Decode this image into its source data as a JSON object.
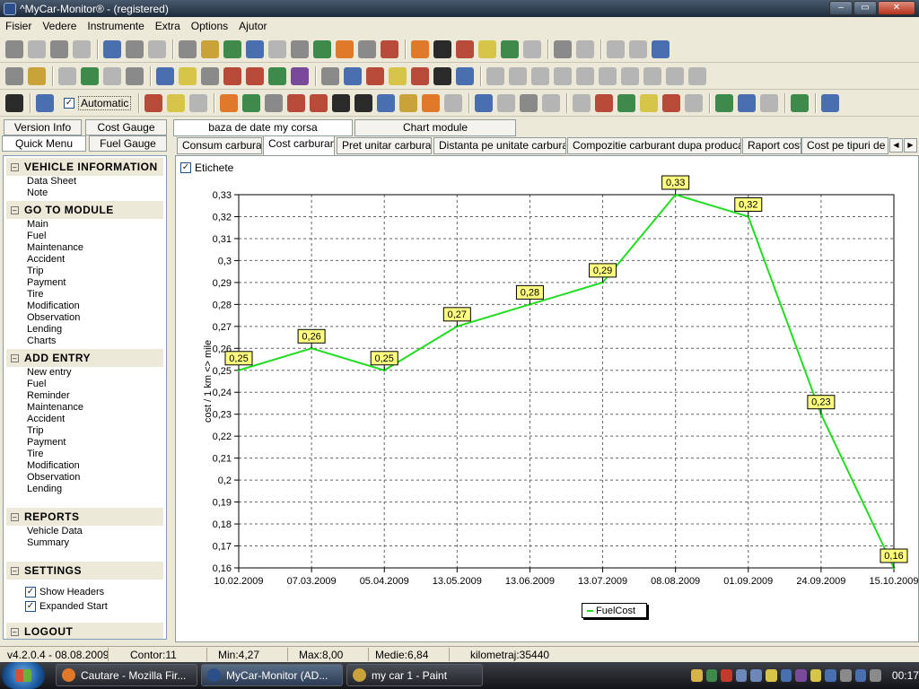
{
  "window": {
    "title": "^MyCar-Monitor® - (registered)",
    "btn_minimize": "–",
    "btn_maximize": "▭",
    "btn_close": "✕"
  },
  "menu": [
    "Fisier",
    "Vedere",
    "Instrumente",
    "Extra",
    "Options",
    "Ajutor"
  ],
  "toolbar": {
    "automatic_label": "Automatic",
    "automatic_checked": "✓"
  },
  "left_tabs": {
    "version_info": "Version Info",
    "cost_gauge": "Cost Gauge",
    "quick_menu": "Quick Menu",
    "fuel_gauge": "Fuel Gauge"
  },
  "sidebar": {
    "vehicle_information": {
      "title": "VEHICLE INFORMATION",
      "items": [
        "Data Sheet",
        "Note"
      ]
    },
    "go_to_module": {
      "title": "GO TO MODULE",
      "items": [
        "Main",
        "Fuel",
        "Maintenance",
        "Accident",
        "Trip",
        "Payment",
        "Tire",
        "Modification",
        "Observation",
        "Lending",
        "Charts"
      ]
    },
    "add_entry": {
      "title": "ADD ENTRY",
      "items": [
        "New entry",
        "Fuel",
        "Reminder",
        "Maintenance",
        "Accident",
        "Trip",
        "Payment",
        "Tire",
        "Modification",
        "Observation",
        "Lending"
      ]
    },
    "reports": {
      "title": "REPORTS",
      "items": [
        "Vehicle Data",
        "Summary"
      ]
    },
    "settings": {
      "title": "SETTINGS",
      "show_headers": "Show Headers",
      "expanded_start": "Expanded Start",
      "check": "✓"
    },
    "logout": {
      "title": "LOGOUT"
    },
    "collapse_symbol": "–"
  },
  "upper_tabs": [
    "baza de date my corsa",
    "Chart module"
  ],
  "chart_tabs": [
    "Consum carburant",
    "Cost carburant",
    "Pret unitar carburant",
    "Distanta pe unitate carburant",
    "Compozitie carburant dupa producatori",
    "Raport cost",
    "Cost pe tipuri de se"
  ],
  "chart_tab_arrows": {
    "left": "◀",
    "right": "▶"
  },
  "etichete": {
    "label": "Etichete",
    "checked": "✓"
  },
  "chart_data": {
    "type": "line",
    "title": "",
    "ylabel": "cost / 1 km <> mile",
    "xlabel": "",
    "categories": [
      "10.02.2009",
      "07.03.2009",
      "05.04.2009",
      "13.05.2009",
      "13.06.2009",
      "13.07.2009",
      "08.08.2009",
      "01.09.2009",
      "24.09.2009",
      "15.10.2009"
    ],
    "series": [
      {
        "name": "FuelCost",
        "values": [
          0.25,
          0.26,
          0.25,
          0.27,
          0.28,
          0.29,
          0.33,
          0.32,
          0.23,
          0.16
        ],
        "labels": [
          "0,25",
          "0,26",
          "0,25",
          "0,27",
          "0,28",
          "0,29",
          "0,33",
          "0,32",
          "0,23",
          "0,16"
        ]
      }
    ],
    "ylim": [
      0.16,
      0.33
    ],
    "yticks": [
      "0,16",
      "0,17",
      "0,18",
      "0,19",
      "0,2",
      "0,21",
      "0,22",
      "0,23",
      "0,24",
      "0,25",
      "0,26",
      "0,27",
      "0,28",
      "0,29",
      "0,3",
      "0,31",
      "0,32",
      "0,33"
    ],
    "grid": true,
    "legend_position": "bottom",
    "line_color": "#22dd22",
    "label_bg_color": "#ffff80"
  },
  "status": {
    "version": "v4.2.0.4 - 08.08.2009",
    "contor": "Contor:11",
    "min": "Min:4,27",
    "max": "Max:8,00",
    "medie": "Medie:6,84",
    "km": "kilometraj:35440"
  },
  "taskbar": {
    "tasks": [
      "Cautare - Mozilla Fir...",
      "MyCar-Monitor (AD...",
      "my car 1 - Paint"
    ],
    "clock": "00:17"
  }
}
